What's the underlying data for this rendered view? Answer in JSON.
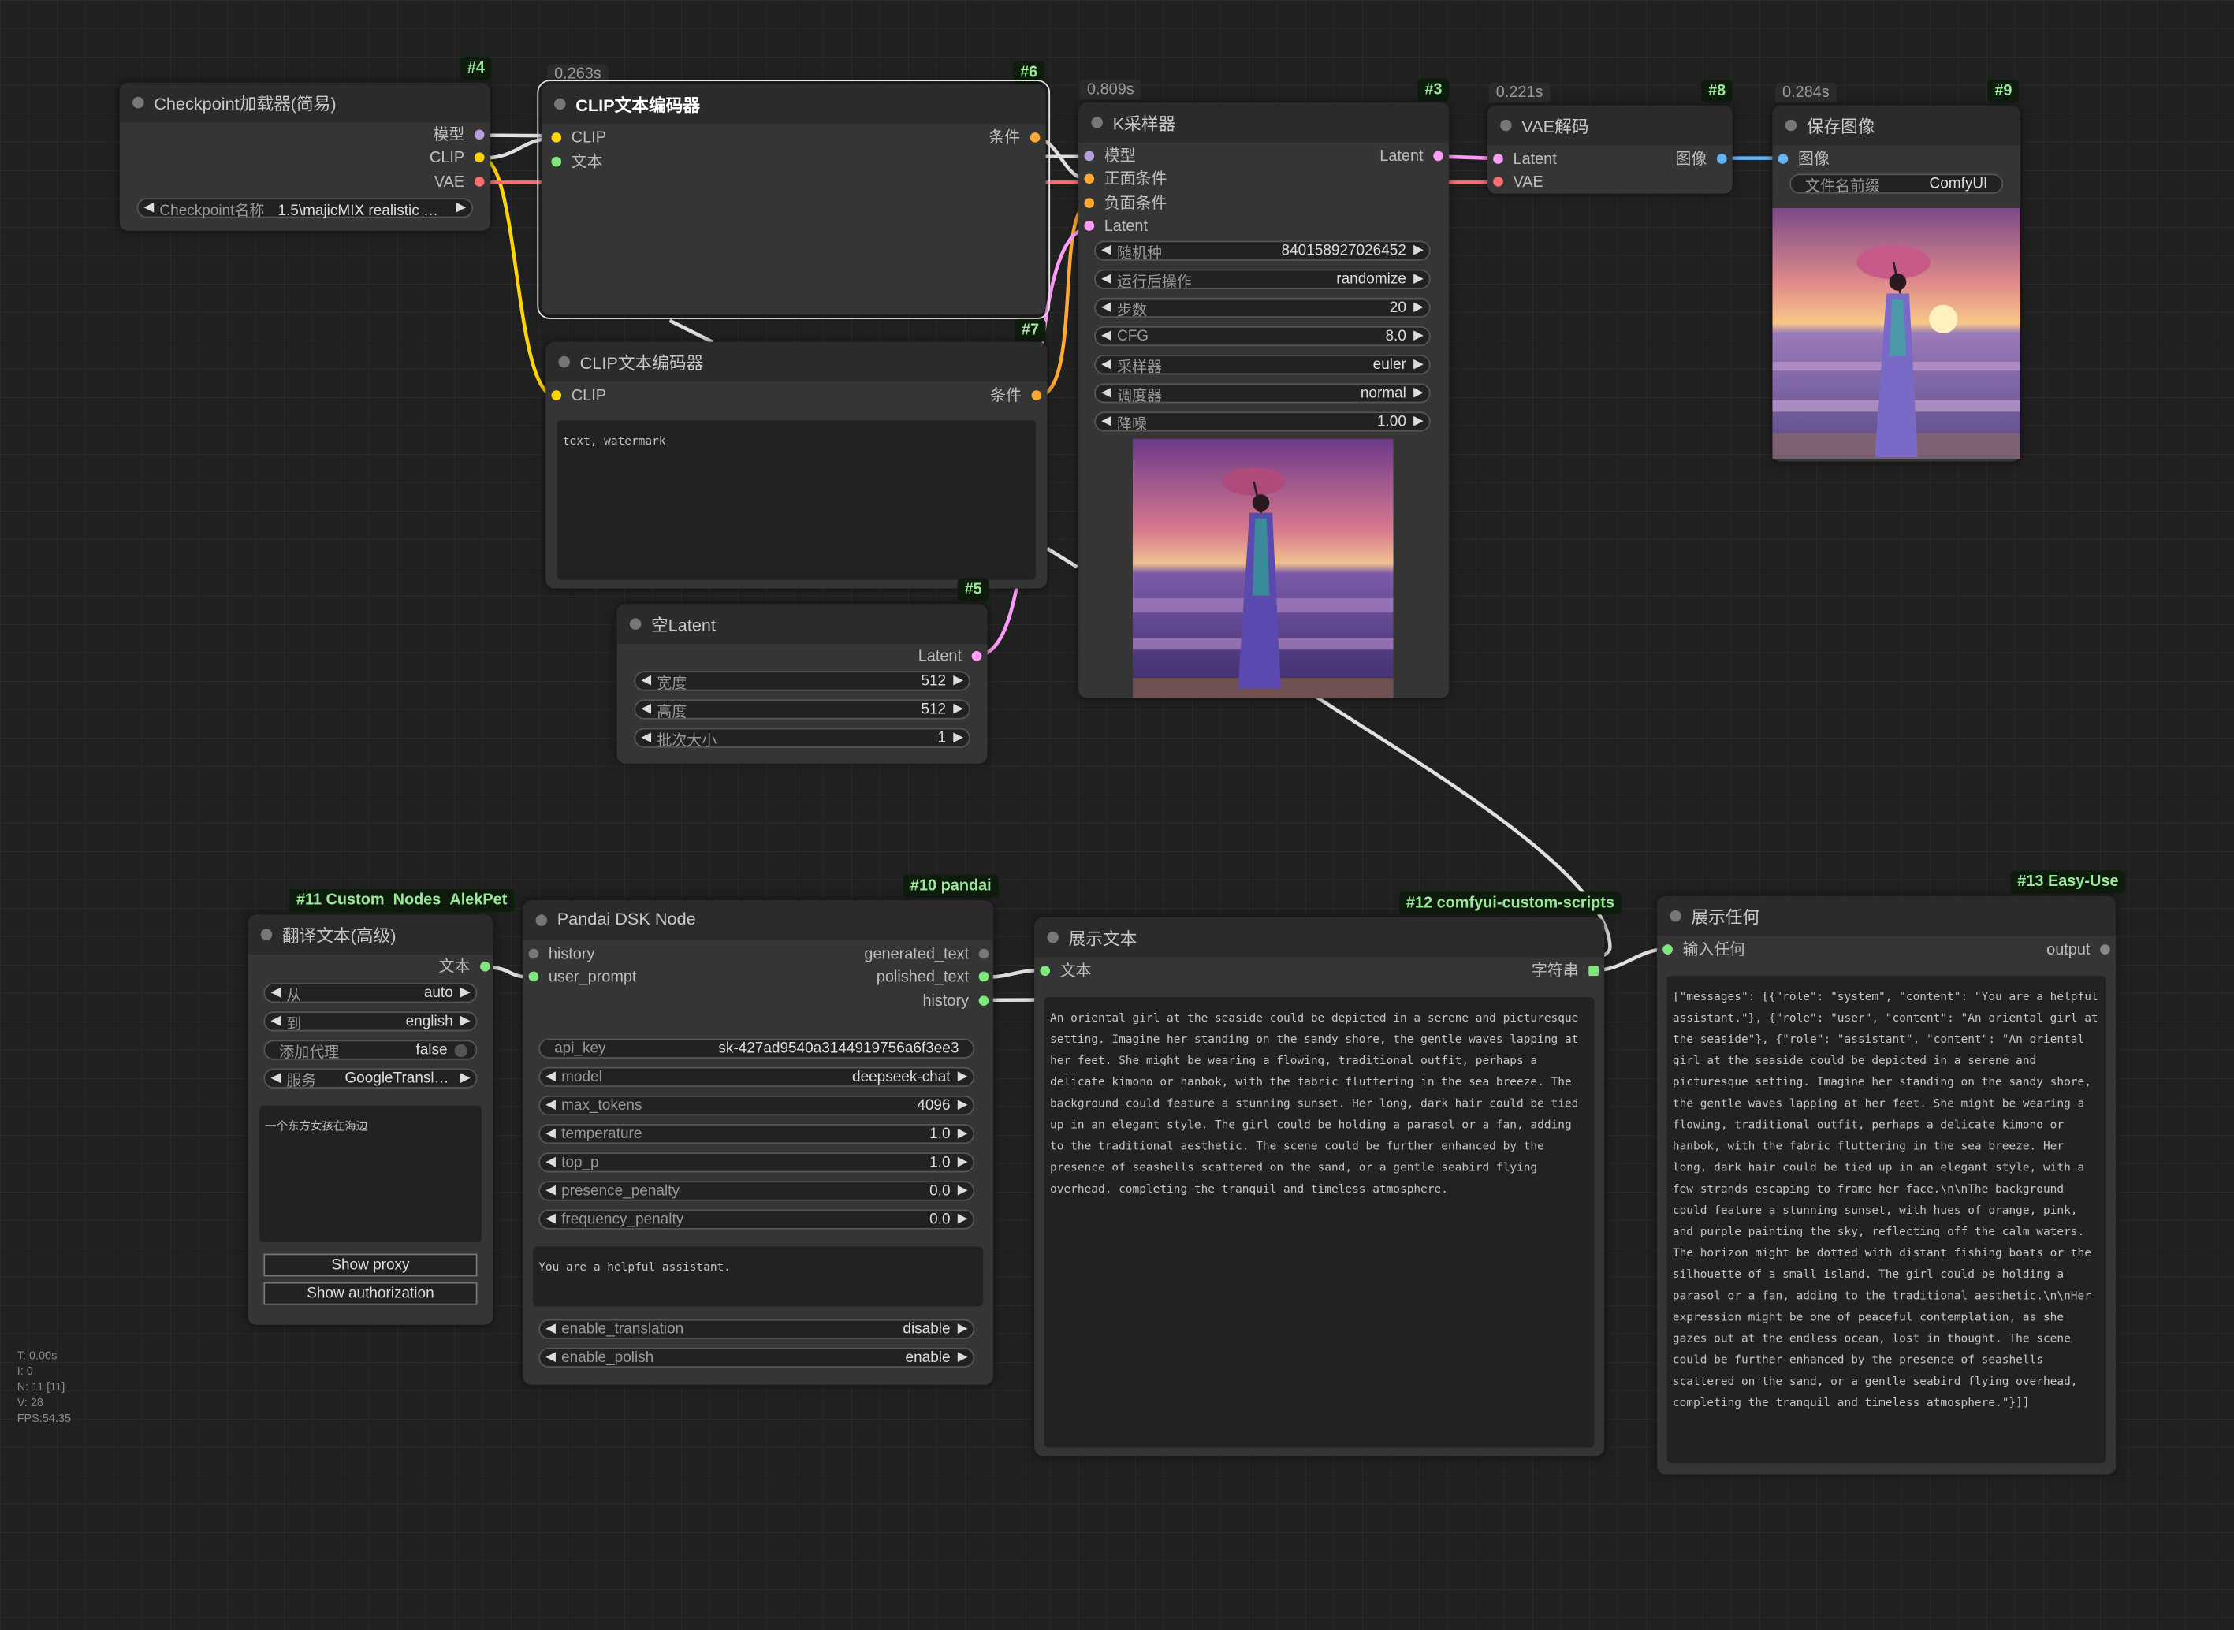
{
  "colors": {
    "model": "#b39ddb",
    "clip": "#ffd500",
    "vae": "#ff6e6e",
    "conditioning": "#ffa931",
    "latent": "#ff9cf9",
    "image": "#64b5f6",
    "string": "#7ee87e",
    "link_default": "#e0e0e0"
  },
  "nodes": {
    "checkpoint": {
      "badge": "#4",
      "title": "Checkpoint加载器(简易)",
      "outputs": [
        "模型",
        "CLIP",
        "VAE"
      ],
      "widget": {
        "label": "Checkpoint名称",
        "value": "1.5\\majicMIX realistic 麦..."
      }
    },
    "clip_pos": {
      "badge": "#6",
      "timing": "0.263s",
      "title": "CLIP文本编码器",
      "inputs": [
        "CLIP",
        "文本"
      ],
      "output": "条件"
    },
    "clip_neg": {
      "badge": "#7",
      "title": "CLIP文本编码器",
      "input": "CLIP",
      "output": "条件",
      "text": "text, watermark"
    },
    "empty_latent": {
      "badge": "#5",
      "title": "空Latent",
      "output": "Latent",
      "widgets": [
        {
          "label": "宽度",
          "value": "512"
        },
        {
          "label": "高度",
          "value": "512"
        },
        {
          "label": "批次大小",
          "value": "1"
        }
      ]
    },
    "ksampler": {
      "badge": "#3",
      "timing": "0.809s",
      "title": "K采样器",
      "inputs": [
        "模型",
        "正面条件",
        "负面条件",
        "Latent"
      ],
      "output": "Latent",
      "widgets": [
        {
          "label": "随机种",
          "value": "840158927026452"
        },
        {
          "label": "运行后操作",
          "value": "randomize"
        },
        {
          "label": "步数",
          "value": "20"
        },
        {
          "label": "CFG",
          "value": "8.0"
        },
        {
          "label": "采样器",
          "value": "euler"
        },
        {
          "label": "调度器",
          "value": "normal"
        },
        {
          "label": "降噪",
          "value": "1.00"
        }
      ]
    },
    "vae_decode": {
      "badge": "#8",
      "timing": "0.221s",
      "title": "VAE解码",
      "inputs": [
        "Latent",
        "VAE"
      ],
      "output": "图像"
    },
    "save_image": {
      "badge": "#9",
      "timing": "0.284s",
      "title": "保存图像",
      "input": "图像",
      "widget": {
        "label": "文件名前缀",
        "value": "ComfyUI"
      }
    },
    "translate": {
      "badge": "#11 Custom_Nodes_AlekPet",
      "title": "翻译文本(高级)",
      "output": "文本",
      "widgets": [
        {
          "label": "从",
          "value": "auto"
        },
        {
          "label": "到",
          "value": "english"
        },
        {
          "label": "添加代理",
          "value": "false"
        },
        {
          "label": "服务",
          "value": "GoogleTranslator"
        }
      ],
      "text": "一个东方女孩在海边",
      "buttons": [
        "Show proxy",
        "Show authorization"
      ]
    },
    "pandai": {
      "badge": "#10 pandai",
      "title": "Pandai DSK Node",
      "inputs": [
        "history",
        "user_prompt"
      ],
      "outputs": [
        "generated_text",
        "polished_text",
        "history"
      ],
      "widgets": [
        {
          "label": "api_key",
          "value": "sk-427ad9540a3144919756a6f3ee3"
        },
        {
          "label": "model",
          "value": "deepseek-chat"
        },
        {
          "label": "max_tokens",
          "value": "4096"
        },
        {
          "label": "temperature",
          "value": "1.0"
        },
        {
          "label": "top_p",
          "value": "1.0"
        },
        {
          "label": "presence_penalty",
          "value": "0.0"
        },
        {
          "label": "frequency_penalty",
          "value": "0.0"
        }
      ],
      "system_text": "You are a helpful assistant.",
      "bottom_widgets": [
        {
          "label": "enable_translation",
          "value": "disable"
        },
        {
          "label": "enable_polish",
          "value": "enable"
        }
      ]
    },
    "show_text": {
      "badge": "#12 comfyui-custom-scripts",
      "title": "展示文本",
      "input": "文本",
      "output": "字符串",
      "text": "An oriental girl at the seaside could be depicted in a serene and picturesque setting. Imagine her standing on the sandy shore, the gentle waves lapping at her feet. She might be wearing a flowing, traditional outfit, perhaps a delicate kimono or hanbok, with the fabric fluttering in the sea breeze. The background could feature a stunning sunset. Her long, dark hair could be tied up in an elegant style. The girl could be holding a parasol or a fan, adding to the traditional aesthetic. The scene could be further enhanced by the presence of seashells scattered on the sand, or a gentle seabird flying overhead, completing the tranquil and timeless atmosphere."
    },
    "show_any": {
      "badge": "#13 Easy-Use",
      "title": "展示任何",
      "input": "输入任何",
      "output": "output",
      "text": "[\"messages\": [{\"role\": \"system\", \"content\": \"You are a helpful assistant.\"}, {\"role\": \"user\", \"content\": \"An oriental girl at the seaside\"}, {\"role\": \"assistant\", \"content\": \"An oriental girl at the seaside could be depicted in a serene and picturesque setting. Imagine her standing on the sandy shore, the gentle waves lapping at her feet. She might be wearing a flowing, traditional outfit, perhaps a delicate kimono or hanbok, with the fabric fluttering in the sea breeze. Her long, dark hair could be tied up in an elegant style, with a few strands escaping to frame her face.\\n\\nThe background could feature a stunning sunset, with hues of orange, pink, and purple painting the sky, reflecting off the calm waters. The horizon might be dotted with distant fishing boats or the silhouette of a small island. The girl could be holding a parasol or a fan, adding to the traditional aesthetic.\\n\\nHer expression might be one of peaceful contemplation, as she gazes out at the endless ocean, lost in thought. The scene could be further enhanced by the presence of seashells scattered on the sand, or a gentle seabird flying overhead, completing the tranquil and timeless atmosphere.\"}]]"
    }
  },
  "stats": [
    "T: 0.00s",
    "I: 0",
    "N: 11 [11]",
    "V: 28",
    "FPS:54.35"
  ]
}
